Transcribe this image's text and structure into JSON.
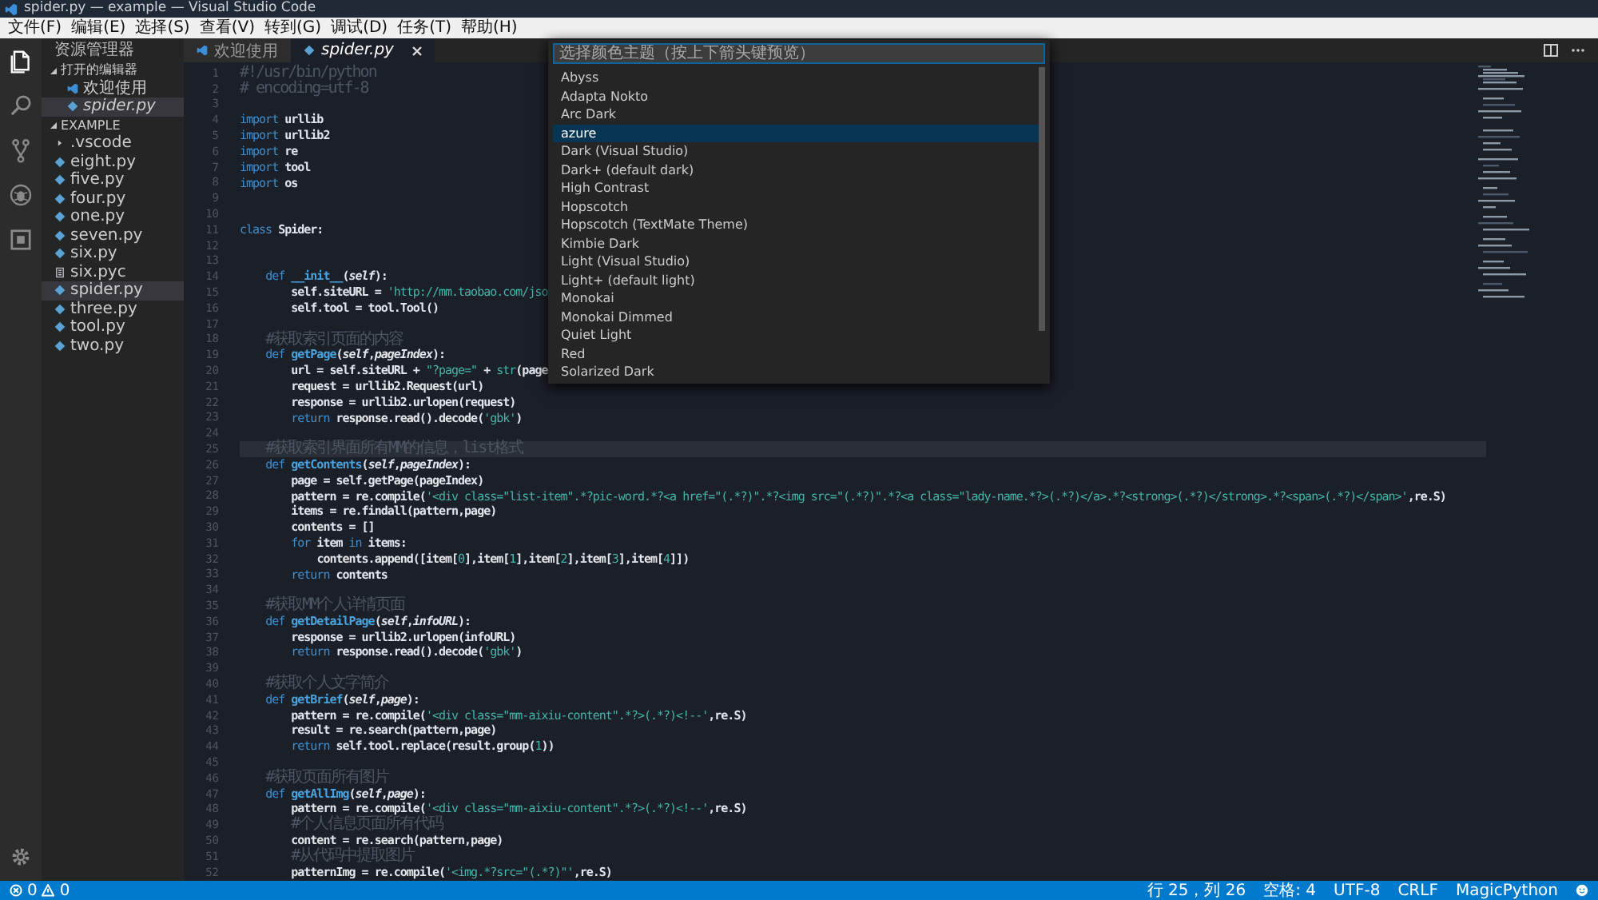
{
  "window": {
    "title": "spider.py — example — Visual Studio Code"
  },
  "menu": [
    "文件(F)",
    "编辑(E)",
    "选择(S)",
    "查看(V)",
    "转到(G)",
    "调试(D)",
    "任务(T)",
    "帮助(H)"
  ],
  "activity_bar": [
    {
      "kind": "files",
      "selected": true
    },
    {
      "kind": "search",
      "selected": false
    },
    {
      "kind": "git",
      "selected": false
    },
    {
      "kind": "debug",
      "selected": false
    },
    {
      "kind": "extensions",
      "selected": false
    },
    {
      "kind": "settings",
      "selected": false
    }
  ],
  "sidebar": {
    "title": "资源管理器",
    "sections": [
      {
        "title": "打开的编辑器",
        "expanded": true,
        "items": [
          {
            "label": "欢迎使用",
            "kind": "vscode",
            "selected": false,
            "preview": false
          },
          {
            "label": "spider.py",
            "kind": "python",
            "selected": true,
            "preview": true
          }
        ]
      },
      {
        "title": "EXAMPLE",
        "expanded": true,
        "items": [
          {
            "label": ".vscode",
            "kind": "folder",
            "selected": false,
            "preview": false
          },
          {
            "label": "eight.py",
            "kind": "python",
            "selected": false,
            "preview": false
          },
          {
            "label": "five.py",
            "kind": "python",
            "selected": false,
            "preview": false
          },
          {
            "label": "four.py",
            "kind": "python",
            "selected": false,
            "preview": false
          },
          {
            "label": "one.py",
            "kind": "python",
            "selected": false,
            "preview": false
          },
          {
            "label": "seven.py",
            "kind": "python",
            "selected": false,
            "preview": false
          },
          {
            "label": "six.py",
            "kind": "python",
            "selected": false,
            "preview": false
          },
          {
            "label": "six.pyc",
            "kind": "file",
            "selected": false,
            "preview": false
          },
          {
            "label": "spider.py",
            "kind": "python",
            "selected": true,
            "preview": false
          },
          {
            "label": "three.py",
            "kind": "python",
            "selected": false,
            "preview": false
          },
          {
            "label": "tool.py",
            "kind": "python",
            "selected": false,
            "preview": false
          },
          {
            "label": "two.py",
            "kind": "python",
            "selected": false,
            "preview": false
          }
        ]
      }
    ]
  },
  "tabs": [
    {
      "label": "欢迎使用",
      "kind": "vscode",
      "selected": false,
      "preview": false
    },
    {
      "label": "spider.py",
      "kind": "python",
      "selected": true,
      "preview": true
    }
  ],
  "editor": {
    "lines": [
      {
        "n": "1",
        "current": false,
        "segs": [
          {
            "kind": "cm",
            "text": "#!/usr/bin/python"
          }
        ]
      },
      {
        "n": "2",
        "current": false,
        "segs": [
          {
            "kind": "cm",
            "text": "# encoding=utf-8"
          }
        ]
      },
      {
        "n": "3",
        "current": false
      },
      {
        "n": "4",
        "current": false,
        "segs": [
          {
            "kind": "kw",
            "text": "import"
          },
          {
            "kind": "id",
            "text": " urllib"
          }
        ]
      },
      {
        "n": "5",
        "current": false,
        "segs": [
          {
            "kind": "kw",
            "text": "import"
          },
          {
            "kind": "id",
            "text": " urllib2"
          }
        ]
      },
      {
        "n": "6",
        "current": false,
        "segs": [
          {
            "kind": "kw",
            "text": "import"
          },
          {
            "kind": "id",
            "text": " re"
          }
        ]
      },
      {
        "n": "7",
        "current": false,
        "segs": [
          {
            "kind": "kw",
            "text": "import"
          },
          {
            "kind": "id",
            "text": " tool"
          }
        ]
      },
      {
        "n": "8",
        "current": false,
        "segs": [
          {
            "kind": "kw",
            "text": "import"
          },
          {
            "kind": "id",
            "text": " os"
          }
        ]
      },
      {
        "n": "9",
        "current": false
      },
      {
        "n": "10",
        "current": false
      },
      {
        "n": "11",
        "current": false,
        "segs": [
          {
            "kind": "kw",
            "text": "class"
          },
          {
            "kind": "id",
            "text": " Spider:"
          }
        ]
      },
      {
        "n": "12",
        "current": false
      },
      {
        "n": "13",
        "current": false
      },
      {
        "n": "14",
        "current": false,
        "segs": [
          {
            "kind": "kw",
            "text": "    def"
          },
          {
            "kind": "fn",
            "text": " __init__"
          },
          {
            "kind": "id",
            "text": "("
          },
          {
            "kind": "self",
            "text": "self"
          },
          {
            "kind": "id",
            "text": "):"
          }
        ]
      },
      {
        "n": "15",
        "current": false,
        "segs": [
          {
            "kind": "id",
            "text": "        self.siteURL = "
          },
          {
            "kind": "str",
            "text": "'http://mm.taobao.com/jso"
          }
        ]
      },
      {
        "n": "16",
        "current": false,
        "segs": [
          {
            "kind": "id",
            "text": "        self.tool = tool.Tool()"
          }
        ]
      },
      {
        "n": "17",
        "current": false
      },
      {
        "n": "18",
        "current": false,
        "segs": [
          {
            "kind": "cm",
            "text": "    #获取索引页面的内容"
          }
        ]
      },
      {
        "n": "19",
        "current": false,
        "segs": [
          {
            "kind": "kw",
            "text": "    def"
          },
          {
            "kind": "fn",
            "text": " getPage"
          },
          {
            "kind": "id",
            "text": "("
          },
          {
            "kind": "self",
            "text": "self"
          },
          {
            "kind": "id",
            "text": ","
          },
          {
            "kind": "param",
            "text": "pageIndex"
          },
          {
            "kind": "id",
            "text": "):"
          }
        ]
      },
      {
        "n": "20",
        "current": false,
        "segs": [
          {
            "kind": "id",
            "text": "        url = self.siteURL + "
          },
          {
            "kind": "str",
            "text": "\"?page=\""
          },
          {
            "kind": "id",
            "text": " + "
          },
          {
            "kind": "bi",
            "text": "str"
          },
          {
            "kind": "id",
            "text": "(page"
          }
        ]
      },
      {
        "n": "21",
        "current": false,
        "segs": [
          {
            "kind": "id",
            "text": "        request = urllib2.Request(url)"
          }
        ]
      },
      {
        "n": "22",
        "current": false,
        "segs": [
          {
            "kind": "id",
            "text": "        response = urllib2.urlopen(request)"
          }
        ]
      },
      {
        "n": "23",
        "current": false,
        "segs": [
          {
            "kind": "kw",
            "text": "        return"
          },
          {
            "kind": "id",
            "text": " response.read().decode("
          },
          {
            "kind": "str",
            "text": "'gbk'"
          },
          {
            "kind": "id",
            "text": ")"
          }
        ]
      },
      {
        "n": "24",
        "current": false
      },
      {
        "n": "25",
        "current": true,
        "segs": [
          {
            "kind": "cm",
            "text": "    #获取索引界面所有MM的信息，list格式"
          }
        ]
      },
      {
        "n": "26",
        "current": false,
        "segs": [
          {
            "kind": "kw",
            "text": "    def"
          },
          {
            "kind": "fn",
            "text": " getContents"
          },
          {
            "kind": "id",
            "text": "("
          },
          {
            "kind": "self",
            "text": "self"
          },
          {
            "kind": "id",
            "text": ","
          },
          {
            "kind": "param",
            "text": "pageIndex"
          },
          {
            "kind": "id",
            "text": "):"
          }
        ]
      },
      {
        "n": "27",
        "current": false,
        "segs": [
          {
            "kind": "id",
            "text": "        page = self.getPage(pageIndex)"
          }
        ]
      },
      {
        "n": "28",
        "current": false,
        "segs": [
          {
            "kind": "id",
            "text": "        pattern = re.compile("
          },
          {
            "kind": "str",
            "text": "'<div class=\"list-item\".*?pic-word.*?<a href=\"(.*?)\".*?<img src=\"(.*?)\".*?<a class=\"lady-name.*?>(.*?)</a>.*?<strong>(.*?)</strong>.*?<span>(.*?)</span>'"
          },
          {
            "kind": "id",
            "text": ",re.S)"
          }
        ]
      },
      {
        "n": "29",
        "current": false,
        "segs": [
          {
            "kind": "id",
            "text": "        items = re.findall(pattern,page)"
          }
        ]
      },
      {
        "n": "30",
        "current": false,
        "segs": [
          {
            "kind": "id",
            "text": "        contents = []"
          }
        ]
      },
      {
        "n": "31",
        "current": false,
        "segs": [
          {
            "kind": "kw",
            "text": "        for"
          },
          {
            "kind": "id",
            "text": " item "
          },
          {
            "kind": "kw",
            "text": "in"
          },
          {
            "kind": "id",
            "text": " items:"
          }
        ]
      },
      {
        "n": "32",
        "current": false,
        "segs": [
          {
            "kind": "id",
            "text": "            contents.append([item["
          },
          {
            "kind": "num",
            "text": "0"
          },
          {
            "kind": "id",
            "text": "],item["
          },
          {
            "kind": "num",
            "text": "1"
          },
          {
            "kind": "id",
            "text": "],item["
          },
          {
            "kind": "num",
            "text": "2"
          },
          {
            "kind": "id",
            "text": "],item["
          },
          {
            "kind": "num",
            "text": "3"
          },
          {
            "kind": "id",
            "text": "],item["
          },
          {
            "kind": "num",
            "text": "4"
          },
          {
            "kind": "id",
            "text": "]])"
          }
        ]
      },
      {
        "n": "33",
        "current": false,
        "segs": [
          {
            "kind": "kw",
            "text": "        return"
          },
          {
            "kind": "id",
            "text": " contents"
          }
        ]
      },
      {
        "n": "34",
        "current": false
      },
      {
        "n": "35",
        "current": false,
        "segs": [
          {
            "kind": "cm",
            "text": "    #获取MM个人详情页面"
          }
        ]
      },
      {
        "n": "36",
        "current": false,
        "segs": [
          {
            "kind": "kw",
            "text": "    def"
          },
          {
            "kind": "fn",
            "text": " getDetailPage"
          },
          {
            "kind": "id",
            "text": "("
          },
          {
            "kind": "self",
            "text": "self"
          },
          {
            "kind": "id",
            "text": ","
          },
          {
            "kind": "param",
            "text": "infoURL"
          },
          {
            "kind": "id",
            "text": "):"
          }
        ]
      },
      {
        "n": "37",
        "current": false,
        "segs": [
          {
            "kind": "id",
            "text": "        response = urllib2.urlopen(infoURL)"
          }
        ]
      },
      {
        "n": "38",
        "current": false,
        "segs": [
          {
            "kind": "kw",
            "text": "        return"
          },
          {
            "kind": "id",
            "text": " response.read().decode("
          },
          {
            "kind": "str",
            "text": "'gbk'"
          },
          {
            "kind": "id",
            "text": ")"
          }
        ]
      },
      {
        "n": "39",
        "current": false
      },
      {
        "n": "40",
        "current": false,
        "segs": [
          {
            "kind": "cm",
            "text": "    #获取个人文字简介"
          }
        ]
      },
      {
        "n": "41",
        "current": false,
        "segs": [
          {
            "kind": "kw",
            "text": "    def"
          },
          {
            "kind": "fn",
            "text": " getBrief"
          },
          {
            "kind": "id",
            "text": "("
          },
          {
            "kind": "self",
            "text": "self"
          },
          {
            "kind": "id",
            "text": ","
          },
          {
            "kind": "param",
            "text": "page"
          },
          {
            "kind": "id",
            "text": "):"
          }
        ]
      },
      {
        "n": "42",
        "current": false,
        "segs": [
          {
            "kind": "id",
            "text": "        pattern = re.compile("
          },
          {
            "kind": "str",
            "text": "'<div class=\"mm-aixiu-content\".*?>(.*?)<!--'"
          },
          {
            "kind": "id",
            "text": ",re.S)"
          }
        ]
      },
      {
        "n": "43",
        "current": false,
        "segs": [
          {
            "kind": "id",
            "text": "        result = re.search(pattern,page)"
          }
        ]
      },
      {
        "n": "44",
        "current": false,
        "segs": [
          {
            "kind": "kw",
            "text": "        return"
          },
          {
            "kind": "id",
            "text": " self.tool.replace(result.group("
          },
          {
            "kind": "num",
            "text": "1"
          },
          {
            "kind": "id",
            "text": "))"
          }
        ]
      },
      {
        "n": "45",
        "current": false
      },
      {
        "n": "46",
        "current": false,
        "segs": [
          {
            "kind": "cm",
            "text": "    #获取页面所有图片"
          }
        ]
      },
      {
        "n": "47",
        "current": false,
        "segs": [
          {
            "kind": "kw",
            "text": "    def"
          },
          {
            "kind": "fn",
            "text": " getAllImg"
          },
          {
            "kind": "id",
            "text": "("
          },
          {
            "kind": "self",
            "text": "self"
          },
          {
            "kind": "id",
            "text": ","
          },
          {
            "kind": "param",
            "text": "page"
          },
          {
            "kind": "id",
            "text": "):"
          }
        ]
      },
      {
        "n": "48",
        "current": false,
        "segs": [
          {
            "kind": "id",
            "text": "        pattern = re.compile("
          },
          {
            "kind": "str",
            "text": "'<div class=\"mm-aixiu-content\".*?>(.*?)<!--'"
          },
          {
            "kind": "id",
            "text": ",re.S)"
          }
        ]
      },
      {
        "n": "49",
        "current": false,
        "segs": [
          {
            "kind": "cm",
            "text": "        #个人信息页面所有代码"
          }
        ]
      },
      {
        "n": "50",
        "current": false,
        "segs": [
          {
            "kind": "id",
            "text": "        content = re.search(pattern,page)"
          }
        ]
      },
      {
        "n": "51",
        "current": false,
        "segs": [
          {
            "kind": "cm",
            "text": "        #从代码中提取图片"
          }
        ]
      },
      {
        "n": "52",
        "current": false,
        "segs": [
          {
            "kind": "id",
            "text": "        patternImg = re.compile("
          },
          {
            "kind": "str",
            "text": "'<img.*?src=\"(.*?)\"'"
          },
          {
            "kind": "id",
            "text": ",re.S)"
          }
        ]
      }
    ]
  },
  "theme_picker": {
    "placeholder": "选择颜色主题（按上下箭头键预览）",
    "items": [
      {
        "label": "Abyss",
        "selected": false
      },
      {
        "label": "Adapta Nokto",
        "selected": false
      },
      {
        "label": "Arc Dark",
        "selected": false
      },
      {
        "label": "azure",
        "selected": true
      },
      {
        "label": "Dark (Visual Studio)",
        "selected": false
      },
      {
        "label": "Dark+ (default dark)",
        "selected": false
      },
      {
        "label": "High Contrast",
        "selected": false
      },
      {
        "label": "Hopscotch",
        "selected": false
      },
      {
        "label": "Hopscotch (TextMate Theme)",
        "selected": false
      },
      {
        "label": "Kimbie Dark",
        "selected": false
      },
      {
        "label": "Light (Visual Studio)",
        "selected": false
      },
      {
        "label": "Light+ (default light)",
        "selected": false
      },
      {
        "label": "Monokai",
        "selected": false
      },
      {
        "label": "Monokai Dimmed",
        "selected": false
      },
      {
        "label": "Quiet Light",
        "selected": false
      },
      {
        "label": "Red",
        "selected": false
      },
      {
        "label": "Solarized Dark",
        "selected": false
      }
    ]
  },
  "status_bar": {
    "errors": "0",
    "warnings": "0",
    "items": [
      "行 25，列 26",
      "空格: 4",
      "UTF-8",
      "CRLF",
      "MagicPython"
    ]
  }
}
